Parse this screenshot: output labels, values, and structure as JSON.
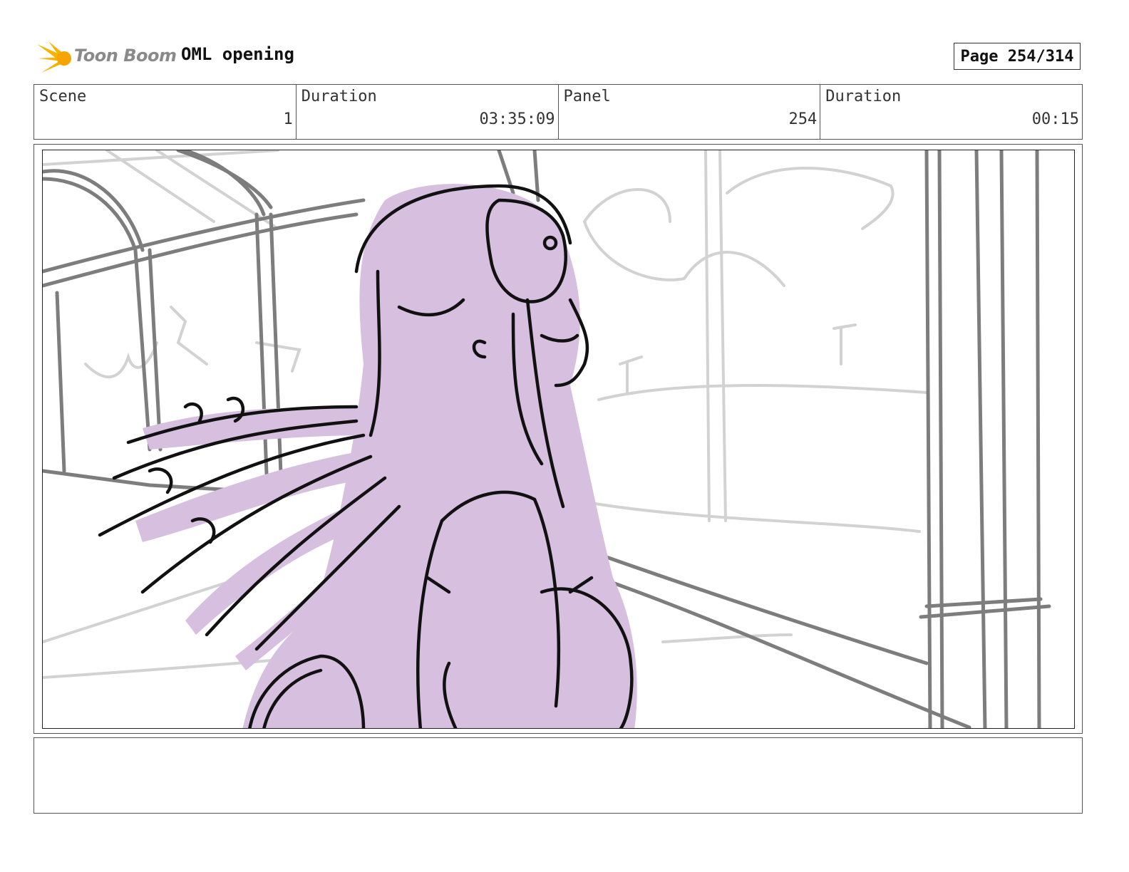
{
  "header": {
    "brand": "Toon Boom",
    "title": "OML opening",
    "page": "Page 254/314"
  },
  "info": {
    "scene_label": "Scene",
    "scene_value": "1",
    "duration_label": "Duration",
    "duration_value": "03:35:09",
    "panel_label": "Panel",
    "panel_value": "254",
    "panel_duration_label": "Duration",
    "panel_duration_value": "00:15"
  },
  "panel": {
    "colors": {
      "fill": "#d7bfdf",
      "ink": "#111111",
      "background_lines": "#808080",
      "light_lines": "#cccccc"
    }
  },
  "notes": {
    "text": ""
  }
}
